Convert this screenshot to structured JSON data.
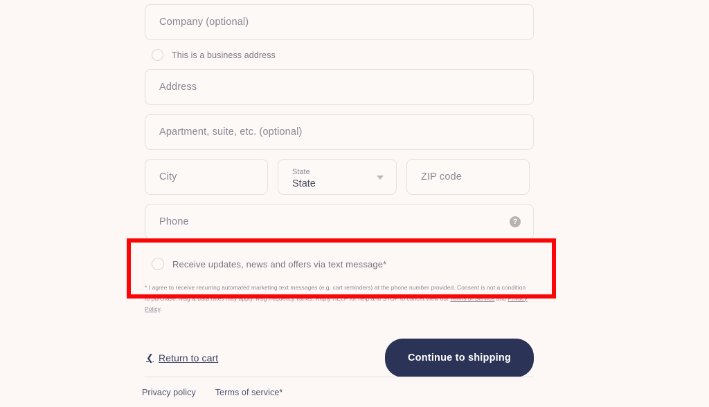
{
  "form": {
    "company": {
      "placeholder": "Company (optional)",
      "value": ""
    },
    "business_address": {
      "label": "This is a business address",
      "checked": false
    },
    "address": {
      "placeholder": "Address",
      "value": ""
    },
    "apartment": {
      "placeholder": "Apartment, suite, etc. (optional)",
      "value": ""
    },
    "city": {
      "placeholder": "City",
      "value": ""
    },
    "state": {
      "float_label": "State",
      "selected": "State",
      "icon": "chevron-down-icon"
    },
    "zip": {
      "placeholder": "ZIP code",
      "value": ""
    },
    "phone": {
      "placeholder": "Phone",
      "value": "",
      "help_icon": "help-circle-icon",
      "help_glyph": "?"
    }
  },
  "sms_consent": {
    "label": "Receive updates, news and offers via text message*",
    "checked": false,
    "fine_print_part1": "* I agree to receive recurring automated marketing text messages (e.g. cart reminders) at the phone number provided. Consent is not a condition to purchase. Msg & data rates may apply. Msg frequency varies. Reply HELP for help and STOP to cancel.View our ",
    "link_terms": "Terms of Service",
    "fine_print_mid": " and ",
    "link_privacy": "Privacy Policy",
    "fine_print_end": "."
  },
  "actions": {
    "return_to_cart": "Return to cart",
    "return_icon": "chevron-left-icon",
    "continue_to_shipping": "Continue to shipping"
  },
  "footer": {
    "privacy_policy": "Privacy policy",
    "terms_of_service": "Terms of service*"
  },
  "annotation": {
    "name": "sms-consent-highlight",
    "color": "#fb0606"
  },
  "colors": {
    "page_background": "#fdf8f5",
    "field_background": "#fcf9f7",
    "field_border": "#e8e0dd",
    "placeholder_text": "#8a8694",
    "primary_button": "#2b3356",
    "link_text": "#4d5370",
    "annotation_red": "#fb0606"
  }
}
